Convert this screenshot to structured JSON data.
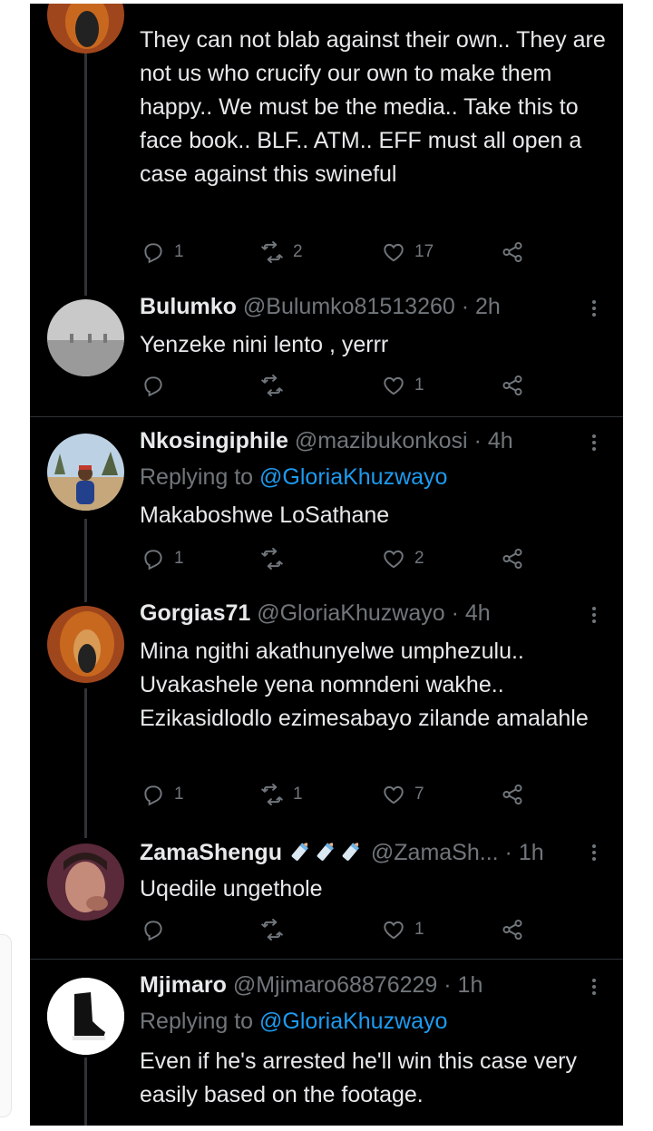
{
  "tweets": [
    {
      "name": "",
      "handle": "",
      "time": "",
      "reply_to_label": "",
      "reply_to_handle": "",
      "body": "They can not blab against their own.. They are not us who crucify our own to make them happy.. We must be the media.. Take this to face book.. BLF.. ATM.. EFF must all open a case against this swineful",
      "counts": {
        "reply": "1",
        "retweet": "2",
        "like": "17"
      }
    },
    {
      "name": "Bulumko",
      "handle": "@Bulumko81513260",
      "time": "· 2h",
      "body": "Yenzeke nini lento , yerrr",
      "counts": {
        "reply": "",
        "retweet": "",
        "like": "1"
      }
    },
    {
      "name": "Nkosingiphile",
      "handle": "@mazibukonkosi",
      "time": "· 4h",
      "reply_to_label": "Replying to",
      "reply_to_handle": "@GloriaKhuzwayo",
      "body": "Makaboshwe LoSathane",
      "counts": {
        "reply": "1",
        "retweet": "",
        "like": "2"
      }
    },
    {
      "name": "Gorgias71",
      "handle": "@GloriaKhuzwayo",
      "time": "· 4h",
      "body": "Mina ngithi akathunyelwe umphezulu.. Uvakashele yena nomndeni wakhe.. Ezikasidlodlo ezimesabayo zilande amalahle",
      "counts": {
        "reply": "1",
        "retweet": "1",
        "like": "7"
      }
    },
    {
      "name": "ZamaShengu",
      "handle": "@ZamaSh...",
      "time": "· 1h",
      "body": "Uqedile ungethole",
      "counts": {
        "reply": "",
        "retweet": "",
        "like": "1"
      }
    },
    {
      "name": "Mjimaro",
      "handle": "@Mjimaro68876229",
      "time": "· 1h",
      "reply_to_label": "Replying to",
      "reply_to_handle": "@GloriaKhuzwayo",
      "body": "Even if he's arrested he'll win this case very easily based on the footage."
    }
  ],
  "icons": {
    "reply": "reply-icon",
    "retweet": "retweet-icon",
    "like": "like-icon",
    "share": "share-icon",
    "more": "more-icon",
    "emoji": "baby-bottle-icon"
  },
  "colors": {
    "background": "#000000",
    "text": "#e7e9ea",
    "secondary": "#71767b",
    "link": "#1d9bf0",
    "divider": "#2f3336"
  }
}
